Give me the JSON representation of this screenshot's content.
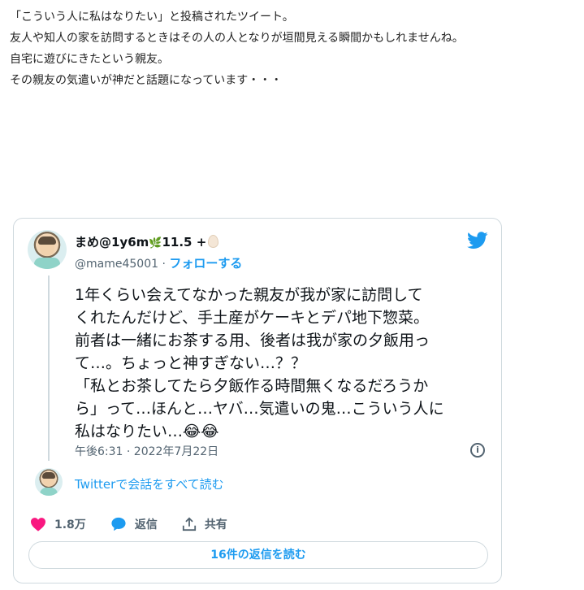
{
  "article": {
    "lines": [
      "「こういう人に私はなりたい」と投稿されたツイート。",
      "友人や知人の家を訪問するときはその人の人となりが垣間見える瞬間かもしれませんね。",
      "自宅に遊びにきたという親友。",
      "その親友の気遣いが神だと話題になっています・・・"
    ]
  },
  "tweet": {
    "display_name": "まめ@1y6m",
    "name_leaf": "🌿",
    "name_suffix": "11.5 +",
    "handle": "@mame45001",
    "separator": "·",
    "follow_label": "フォローする",
    "text_lines": [
      "1年くらい会えてなかった親友が我が家に訪問して",
      "くれたんだけど、手土産がケーキとデパ地下惣菜。",
      "前者は一緒にお茶する用、後者は我が家の夕飯用っ",
      "て…。ちょっと神すぎない…？？",
      "「私とお茶してたら夕飯作る時間無くなるだろうか",
      "ら」って…ほんと…ヤバ…気遣いの鬼…こういう人に",
      "私はなりたい…😂😂"
    ],
    "date": "午後6:31 · 2022年7月22日",
    "info_glyph": "i",
    "read_all_label": "Twitterで会話をすべて読む",
    "likes": "1.8万",
    "reply_label": "返信",
    "share_label": "共有",
    "more_replies_label": "16件の返信を読む"
  },
  "colors": {
    "accent": "#1d9bf0",
    "like": "#f91880",
    "text": "#0f1419",
    "muted": "#536471",
    "border": "#cfd9de"
  },
  "icons": [
    "twitter-bird-icon",
    "heart-icon",
    "reply-icon",
    "share-icon",
    "info-icon"
  ]
}
